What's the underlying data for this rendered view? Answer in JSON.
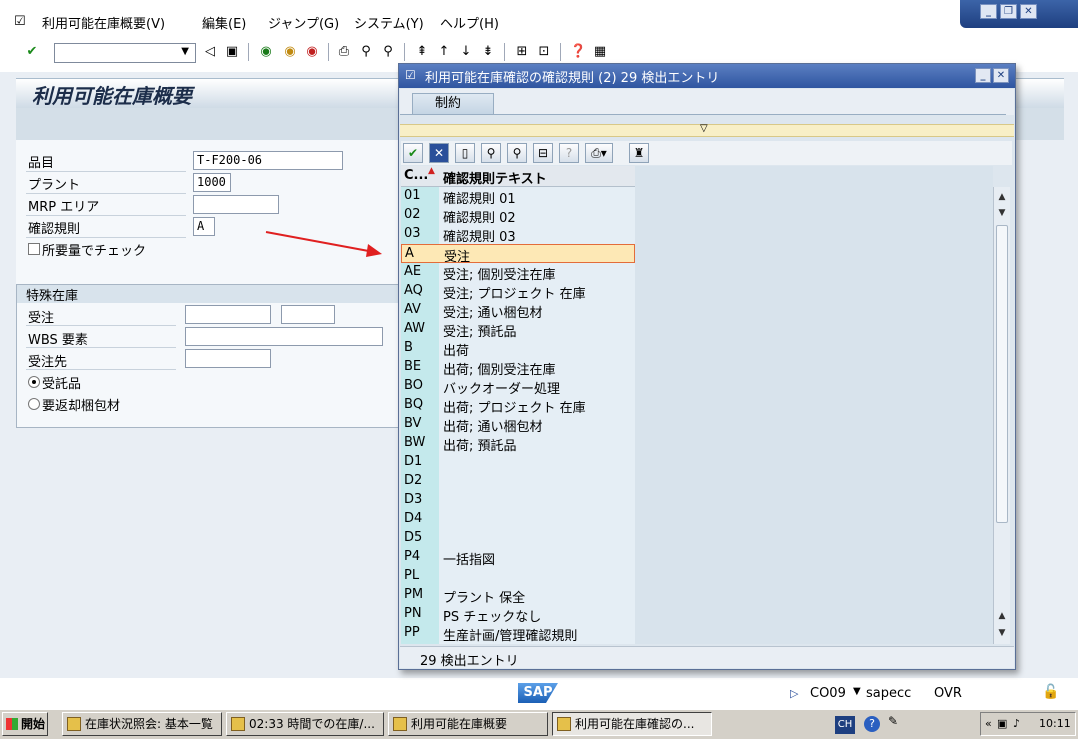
{
  "menubar": {
    "items": [
      "利用可能在庫概要(V)",
      "編集(E)",
      "ジャンプ(G)",
      "システム(Y)",
      "ヘルプ(H)"
    ]
  },
  "window_controls": {
    "minimize": "_",
    "restore": "❐",
    "close": "✕"
  },
  "page": {
    "title": "利用可能在庫概要"
  },
  "form": {
    "material_label": "品目",
    "material_value": "T-F200-06",
    "plant_label": "プラント",
    "plant_value": "1000",
    "mrp_area_label": "MRP エリア",
    "mrp_area_value": "",
    "checking_rule_label": "確認規則",
    "checking_rule_value": "A",
    "check_requirement_label": "所要量でチェック"
  },
  "special_stock": {
    "group_title": "特殊在庫",
    "sales_order_label": "受注",
    "wbs_label": "WBS 要素",
    "customer_label": "受注先",
    "radio_consignment": "受託品",
    "radio_returnable": "要返却梱包材",
    "selected_radio": "consignment"
  },
  "dialog": {
    "title": "利用可能在庫確認の確認規則 (2)   29 検出エントリ",
    "tab_label": "制約",
    "col_key_header": "C...",
    "col_text_header": "確認規則テキスト",
    "rows": [
      {
        "key": "01",
        "text": "確認規則 01"
      },
      {
        "key": "02",
        "text": "確認規則 02"
      },
      {
        "key": "03",
        "text": "確認規則 03"
      },
      {
        "key": "A",
        "text": "受注"
      },
      {
        "key": "AE",
        "text": "受注; 個別受注在庫"
      },
      {
        "key": "AQ",
        "text": "受注; プロジェクト 在庫"
      },
      {
        "key": "AV",
        "text": "受注; 通い梱包材"
      },
      {
        "key": "AW",
        "text": "受注; 預託品"
      },
      {
        "key": "B",
        "text": "出荷"
      },
      {
        "key": "BE",
        "text": "出荷; 個別受注在庫"
      },
      {
        "key": "BO",
        "text": "バックオーダー処理"
      },
      {
        "key": "BQ",
        "text": "出荷; プロジェクト 在庫"
      },
      {
        "key": "BV",
        "text": "出荷; 通い梱包材"
      },
      {
        "key": "BW",
        "text": "出荷; 預託品"
      },
      {
        "key": "D1",
        "text": ""
      },
      {
        "key": "D2",
        "text": ""
      },
      {
        "key": "D3",
        "text": ""
      },
      {
        "key": "D4",
        "text": ""
      },
      {
        "key": "D5",
        "text": ""
      },
      {
        "key": "P4",
        "text": "一括指図"
      },
      {
        "key": "PL",
        "text": ""
      },
      {
        "key": "PM",
        "text": "プラント 保全"
      },
      {
        "key": "PN",
        "text": "PS チェックなし"
      },
      {
        "key": "PP",
        "text": "生産計画/管理確認規則"
      }
    ],
    "selected_key": "A",
    "status_text": "29 検出エントリ"
  },
  "statusbar": {
    "sap_logo": "SAP",
    "transaction": "CO09",
    "server": "sapecc",
    "mode": "OVR"
  },
  "taskbar": {
    "start_label": "開始",
    "tasks": [
      "在庫状況照会: 基本一覧",
      "02:33 時間での在庫/...",
      "利用可能在庫概要",
      "利用可能在庫確認の..."
    ],
    "lang": "CH",
    "clock": "10:11"
  },
  "colors": {
    "title_bar": "#2f55a0",
    "key_column": "#c4e9ec",
    "selected_row_border": "#e36c3a",
    "annotation_arrow": "#e02020"
  }
}
